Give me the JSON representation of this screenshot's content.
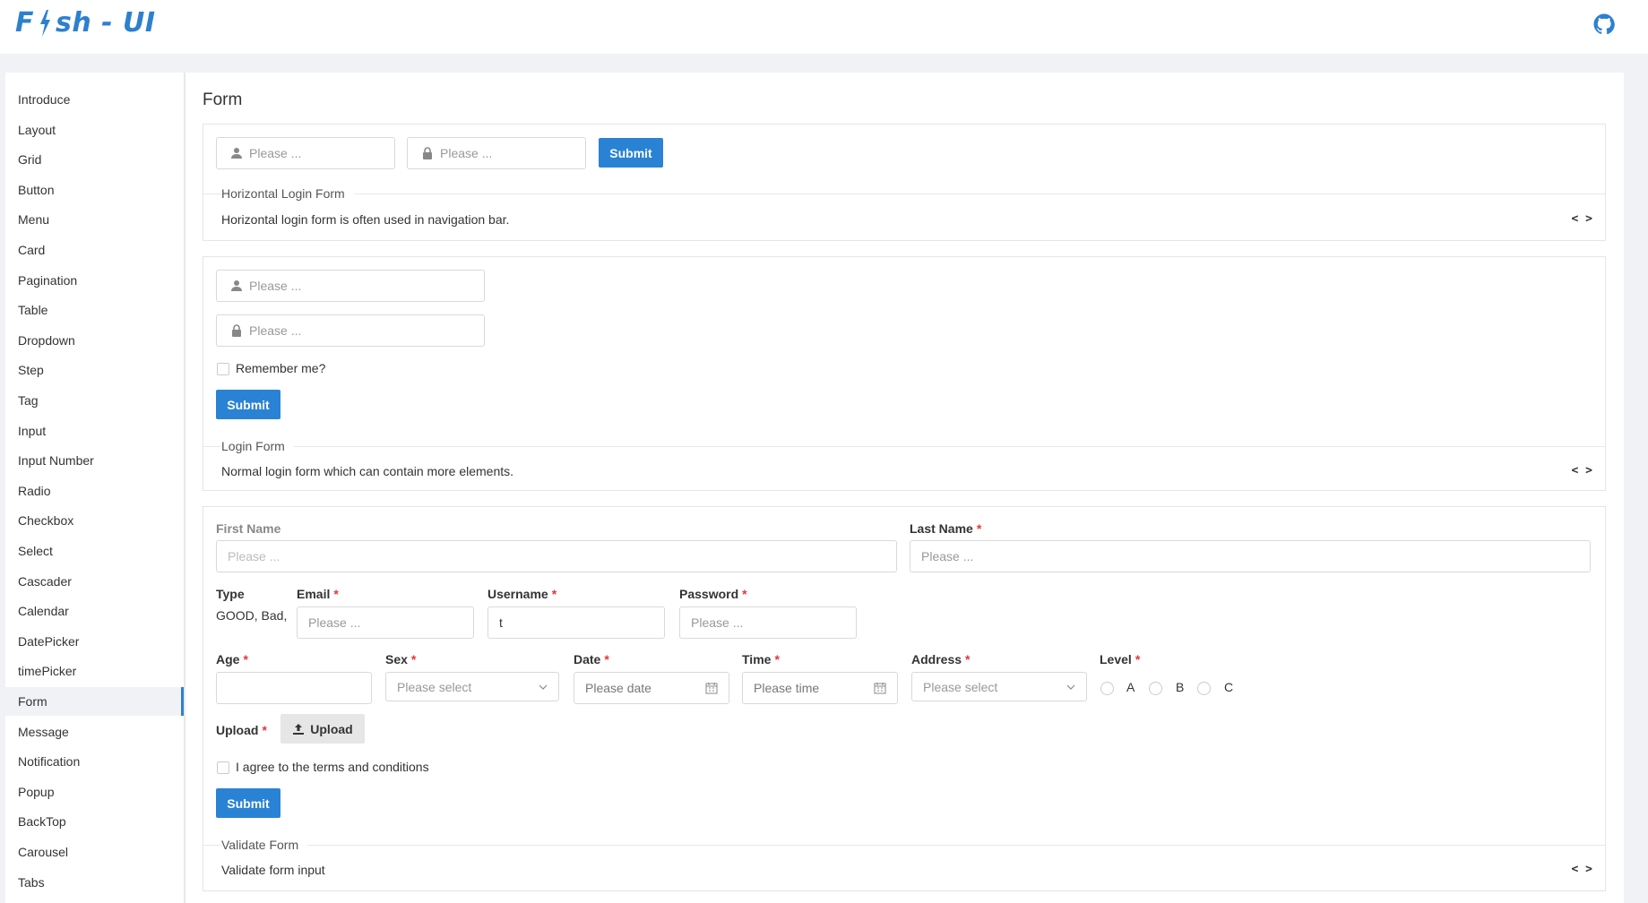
{
  "header": {
    "logo_left": "F",
    "logo_right": "sh - UI",
    "github_icon": "github-icon",
    "brand_color": "#2d80cf"
  },
  "sidebar": {
    "items": [
      "Introduce",
      "Layout",
      "Grid",
      "Button",
      "Menu",
      "Card",
      "Pagination",
      "Table",
      "Dropdown",
      "Step",
      "Tag",
      "Input",
      "Input Number",
      "Radio",
      "Checkbox",
      "Select",
      "Cascader",
      "Calendar",
      "DatePicker",
      "timePicker",
      "Form",
      "Message",
      "Notification",
      "Popup",
      "BackTop",
      "Carousel",
      "Tabs"
    ],
    "active": "Form"
  },
  "page": {
    "title": "Form"
  },
  "demo1": {
    "user_placeholder": "Please ...",
    "pass_placeholder": "Please ...",
    "submit": "Submit",
    "title": "Horizontal Login Form",
    "description": "Horizontal login form is often used in navigation bar."
  },
  "demo2": {
    "user_placeholder": "Please ...",
    "pass_placeholder": "Please ...",
    "remember": "Remember me?",
    "submit": "Submit",
    "title": "Login Form",
    "description": "Normal login form which can contain more elements."
  },
  "demo3": {
    "first_name_label": "First Name",
    "first_name_placeholder": "Please ...",
    "last_name_label": "Last Name",
    "last_name_placeholder": "Please ...",
    "type_label": "Type",
    "type_value": "GOOD, Bad,",
    "email_label": "Email",
    "email_placeholder": "Please ...",
    "username_label": "Username",
    "username_value": "t",
    "password_label": "Password",
    "password_placeholder": "Please ...",
    "age_label": "Age",
    "sex_label": "Sex",
    "sex_placeholder": "Please select",
    "date_label": "Date",
    "date_placeholder": "Please date",
    "time_label": "Time",
    "time_placeholder": "Please time",
    "address_label": "Address",
    "address_placeholder": "Please select",
    "level_label": "Level",
    "level_options": [
      "A",
      "B",
      "C"
    ],
    "upload_label": "Upload",
    "upload_button": "Upload",
    "agree": "I agree to the terms and conditions",
    "submit": "Submit",
    "title": "Validate Form",
    "description": "Validate form input",
    "required_mark": "*"
  },
  "code_toggle": "< >"
}
